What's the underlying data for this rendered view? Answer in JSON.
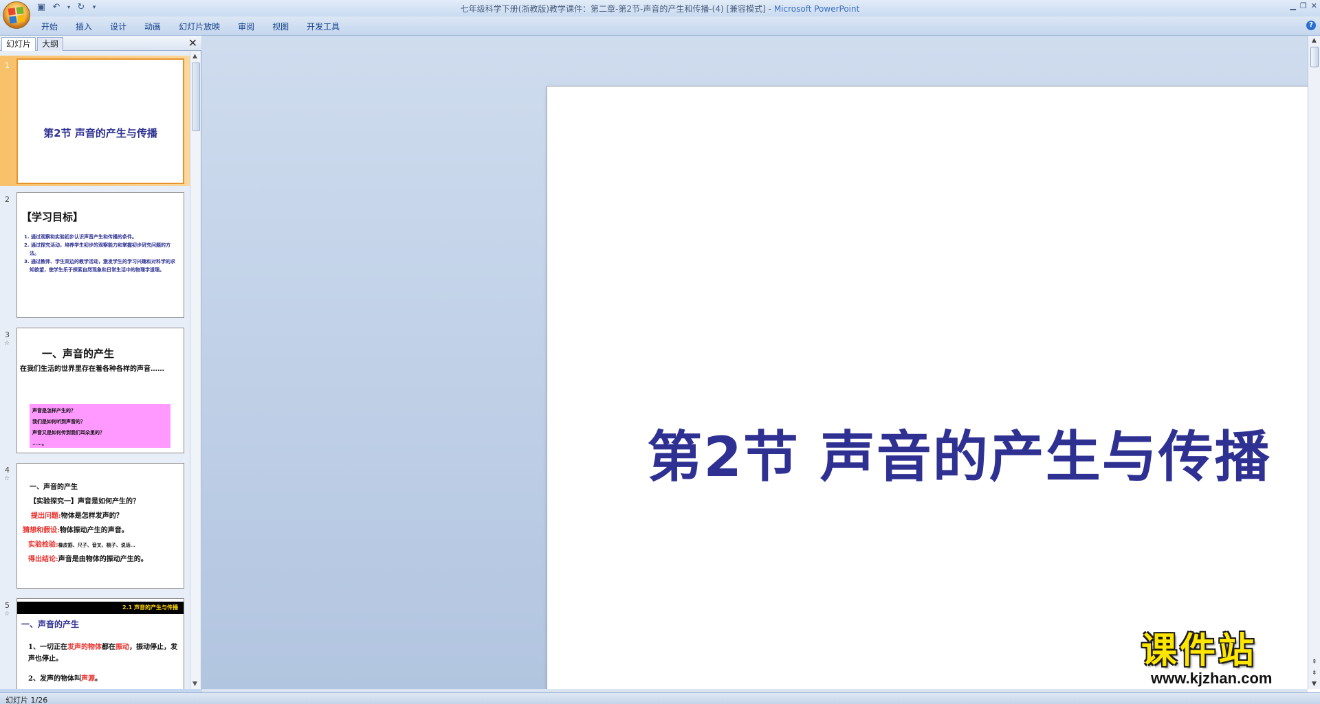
{
  "window": {
    "title_doc": "七年级科学下册(浙教版)教学课件：第二章-第2节-声音的产生和传播-(4) [兼容模式]",
    "title_sep": " - ",
    "title_app": "Microsoft PowerPoint"
  },
  "ribbon": {
    "tabs": [
      "开始",
      "插入",
      "设计",
      "动画",
      "幻灯片放映",
      "审阅",
      "视图",
      "开发工具"
    ]
  },
  "panel": {
    "tab_slides": "幻灯片",
    "tab_outline": "大纲",
    "close_glyph": "✕"
  },
  "thumbnails": [
    {
      "num": "1",
      "title": "第2节 声音的产生与传播"
    },
    {
      "num": "2",
      "star": "☆",
      "heading": "【学习目标】",
      "items": [
        "1. 通过观察和实验初步认识声音产生和传播的条件。",
        "2. 通过探究活动，培养学生初步的观察能力和掌握初步研究问题的方法。",
        "3. 通过教师、学生双边的教学活动，激发学生的学习兴趣和对科学的求知欲望，使学生乐于探索自然现象和日常生活中的物理学道理。"
      ]
    },
    {
      "num": "3",
      "star": "☆",
      "title": "一、声音的产生",
      "body": "在我们生活的世界里存在着各种各样的声音……",
      "box": [
        "声音是怎样产生的？",
        "我们是如何听到声音的？",
        "声音又是如何传到我们耳朵里的？",
        "……。"
      ]
    },
    {
      "num": "4",
      "star": "☆",
      "l1": "一、声音的产生",
      "l2": "【实验探究一】声音是如何产生的？",
      "l3a": "提出问题:",
      "l3b": "物体是怎样发声的？",
      "l4a": "猜想和假设:",
      "l4b": "物体振动产生的声音。",
      "l5a": "实验检验:",
      "l5b": "橡皮筋、尺子、音叉、桃子、说话…",
      "l6a": "得出结论:",
      "l6b": "声音是由物体的振动产生的。"
    },
    {
      "num": "5",
      "star": "☆",
      "bar": "2.1 声音的产生与传播",
      "sub": "一、声音的产生",
      "p1a": "1、一切正在",
      "p1b": "发声的物体",
      "p1c": "都在",
      "p1d": "振动",
      "p1e": "，振动停止，发声也停止。",
      "p2a": "2、发声的物体叫",
      "p2b": "声源",
      "p2c": "。"
    }
  ],
  "slide": {
    "title": "第2节 声音的产生与传播"
  },
  "watermark": {
    "cn": "课件站",
    "url": "www.kjzhan.com"
  },
  "status": {
    "text": "幻灯片 1/26"
  },
  "colors": {
    "title_blue": "#2e3192",
    "accent_red": "#e8312c",
    "selection_orange": "#f8c16a"
  }
}
